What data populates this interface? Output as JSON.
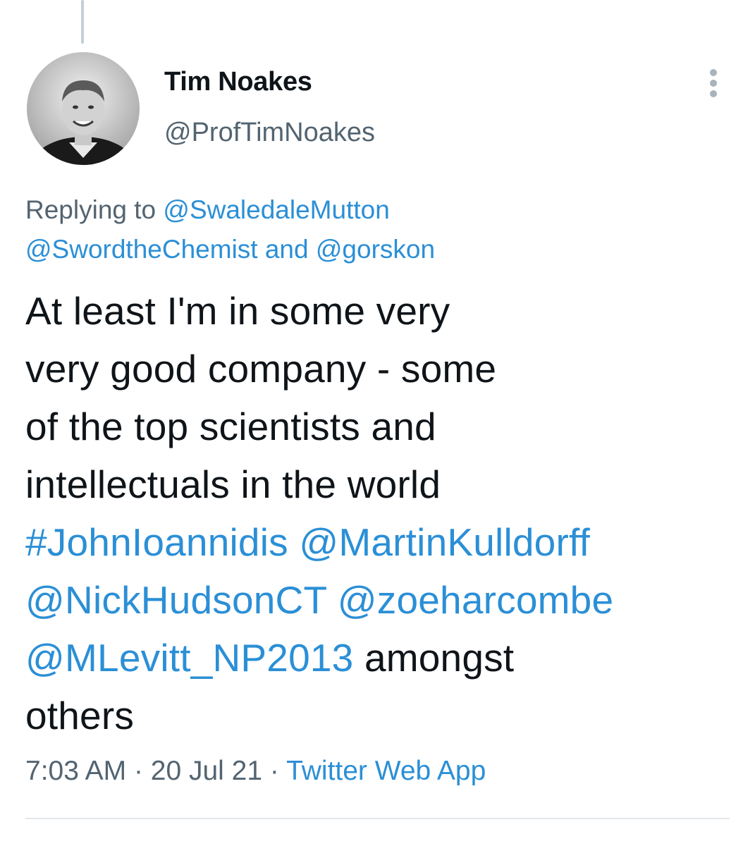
{
  "tweet": {
    "author": {
      "display_name": "Tim Noakes",
      "handle": "@ProfTimNoakes"
    },
    "reply_context": {
      "prefix": "Replying to",
      "mention_1": "@SwaledaleMutton",
      "mention_2": "@SwordtheChemist",
      "conjunction": "and",
      "mention_3": "@gorskon"
    },
    "text": {
      "line_1": "At least I'm in some very",
      "line_2": "very good company - some",
      "line_3": "of the top scientists and",
      "line_4": "intellectuals in the world",
      "hashtag": "#JohnIoannidis",
      "mention_a": "@MartinKulldorff",
      "mention_b": "@NickHudsonCT",
      "mention_c": "@zoeharcombe",
      "mention_d": "@MLevitt_NP2013",
      "tail_1": "amongst",
      "tail_2": "others"
    },
    "meta": {
      "time": "7:03 AM",
      "separator": "·",
      "date": "20 Jul 21",
      "source": "Twitter Web App"
    }
  },
  "icons": {
    "more": "more-vertical-icon"
  },
  "colors": {
    "link": "#2b8fd6",
    "secondary_text": "#536471",
    "primary_text": "#0f1419",
    "thread_line": "#c4cfd6"
  }
}
